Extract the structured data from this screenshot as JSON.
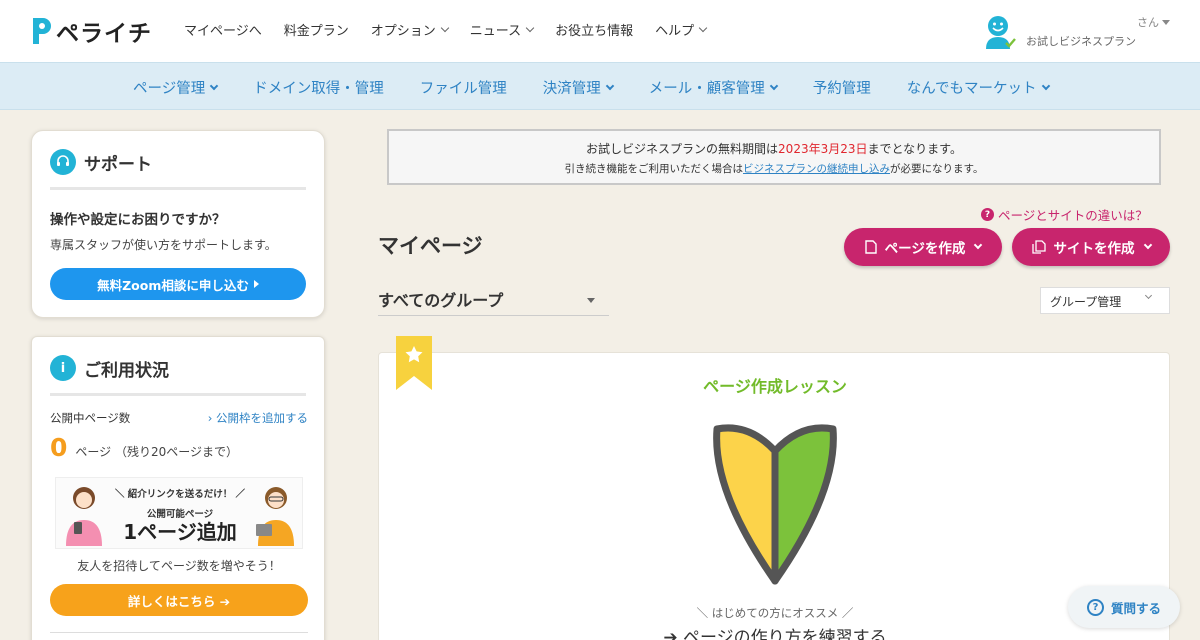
{
  "brand": {
    "name": "ペライチ",
    "logo_color": "#22b3d6"
  },
  "topnav": [
    {
      "label": "マイページへ",
      "dropdown": false
    },
    {
      "label": "料金プラン",
      "dropdown": false
    },
    {
      "label": "オプション",
      "dropdown": true
    },
    {
      "label": "ニュース",
      "dropdown": true
    },
    {
      "label": "お役立ち情報",
      "dropdown": false
    },
    {
      "label": "ヘルプ",
      "dropdown": true
    }
  ],
  "user": {
    "name_suffix": "さん",
    "plan": "お試しビジネスプラン"
  },
  "subnav": [
    {
      "label": "ページ管理",
      "dropdown": true
    },
    {
      "label": "ドメイン取得・管理",
      "dropdown": false
    },
    {
      "label": "ファイル管理",
      "dropdown": false
    },
    {
      "label": "決済管理",
      "dropdown": true
    },
    {
      "label": "メール・顧客管理",
      "dropdown": true
    },
    {
      "label": "予約管理",
      "dropdown": false
    },
    {
      "label": "なんでもマーケット",
      "dropdown": true
    }
  ],
  "support": {
    "title": "サポート",
    "question": "操作や設定にお困りですか？",
    "description": "専属スタッフが使い方をサポートします。",
    "button": "無料Zoom相談に申し込む"
  },
  "usage": {
    "title": "ご利用状況",
    "published_label": "公開中ページ数",
    "add_link": "› 公開枠を追加する",
    "count": "0",
    "count_text": "ページ （残り20ページまで）",
    "banner": {
      "top": "＼ 紹介リンクを送るだけ！ ／",
      "mid": "公開可能ページ",
      "big": "1ページ追加"
    },
    "invite": "友人を招待してページ数を増やそう！",
    "detail_button": "詳しくはこちら ➔"
  },
  "notice": {
    "line1_pre": "お試しビジネスプランの無料期間は",
    "line1_date": "2023年3月23日",
    "line1_post": "までとなります。",
    "line2_pre": "引き続き機能をご利用いただく場合は",
    "line2_link": "ビジネスプランの継続申し込み",
    "line2_post": "が必要になります。"
  },
  "main": {
    "diff_link": "ページとサイトの違いは？",
    "title": "マイページ",
    "create_page": "ページを作成",
    "create_site": "サイトを作成",
    "group_select": "すべてのグループ",
    "group_manage": "グループ管理"
  },
  "lesson": {
    "title": "ページ作成レッスン",
    "sub": "＼ はじめての方にオススメ ／",
    "cta": "➔ ページの作り方を練習する"
  },
  "help": {
    "label": "質問する"
  },
  "colors": {
    "accent_pink": "#c8256d",
    "accent_blue": "#1e96ee",
    "accent_orange": "#f7a21b",
    "lesson_green": "#72bb2a",
    "notice_red": "#e0262e",
    "background": "#f3efe6"
  },
  "icons": {
    "support": "headset-icon",
    "usage": "info-icon",
    "lesson": "wakaba-mark-icon",
    "ribbon": "star-ribbon-icon"
  }
}
